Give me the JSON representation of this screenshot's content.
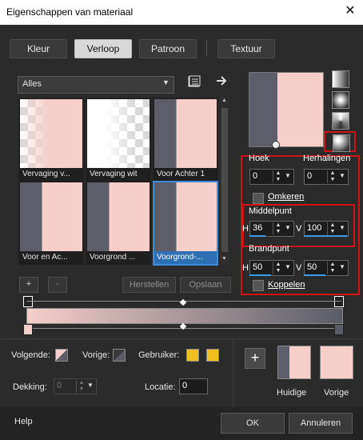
{
  "window": {
    "title": "Eigenschappen van materiaal",
    "close_glyph": "✕"
  },
  "tabs": [
    {
      "label": "Kleur",
      "active": false
    },
    {
      "label": "Verloop",
      "active": true
    },
    {
      "label": "Patroon",
      "active": false
    },
    {
      "label": "Textuur",
      "active": false
    }
  ],
  "category": {
    "selected": "Alles"
  },
  "gradients": [
    {
      "label": "Vervaging v...",
      "style": "checker-pink"
    },
    {
      "label": "Vervaging wit",
      "style": "white-checker"
    },
    {
      "label": "Voor Achter 1",
      "style": "dark-pink"
    },
    {
      "label": "Voor en Ac...",
      "style": "dark-pink-split"
    },
    {
      "label": "Voorgrond ...",
      "style": "dark-pink-split2"
    },
    {
      "label": "Voorgrond-...",
      "style": "dark-pink-split3",
      "selected": true
    }
  ],
  "grid_buttons": {
    "add": "+",
    "remove": "-",
    "restore": "Herstellen",
    "save": "Opslaan"
  },
  "properties": {
    "angle_label": "Hoek",
    "angle_value": "0",
    "repeats_label": "Herhalingen",
    "repeats_value": "0",
    "invert_label": "Omkeren",
    "center_label": "Middelpunt",
    "center_h_label": "H",
    "center_h_value": "36",
    "center_v_label": "V",
    "center_v_value": "100",
    "focal_label": "Brandpunt",
    "focal_h_label": "H",
    "focal_h_value": "50",
    "focal_v_label": "V",
    "focal_v_value": "50",
    "link_label": "Koppelen"
  },
  "colors": {
    "accent": "#3d8bd8",
    "highlight": "#d0121b",
    "gradient_start": "#f6cfcb",
    "gradient_end": "#5a5d68",
    "user_color": "#f0c020"
  },
  "editor": {
    "next_label": "Volgende:",
    "prev_label": "Vorige:",
    "user_label": "Gebruiker:",
    "opacity_label": "Dekking:",
    "opacity_value": "0",
    "location_label": "Locatie:",
    "location_value": "0"
  },
  "swatches": {
    "current_label": "Huidige",
    "previous_label": "Vorige"
  },
  "footer": {
    "help": "Help",
    "ok": "OK",
    "cancel": "Annuleren"
  }
}
